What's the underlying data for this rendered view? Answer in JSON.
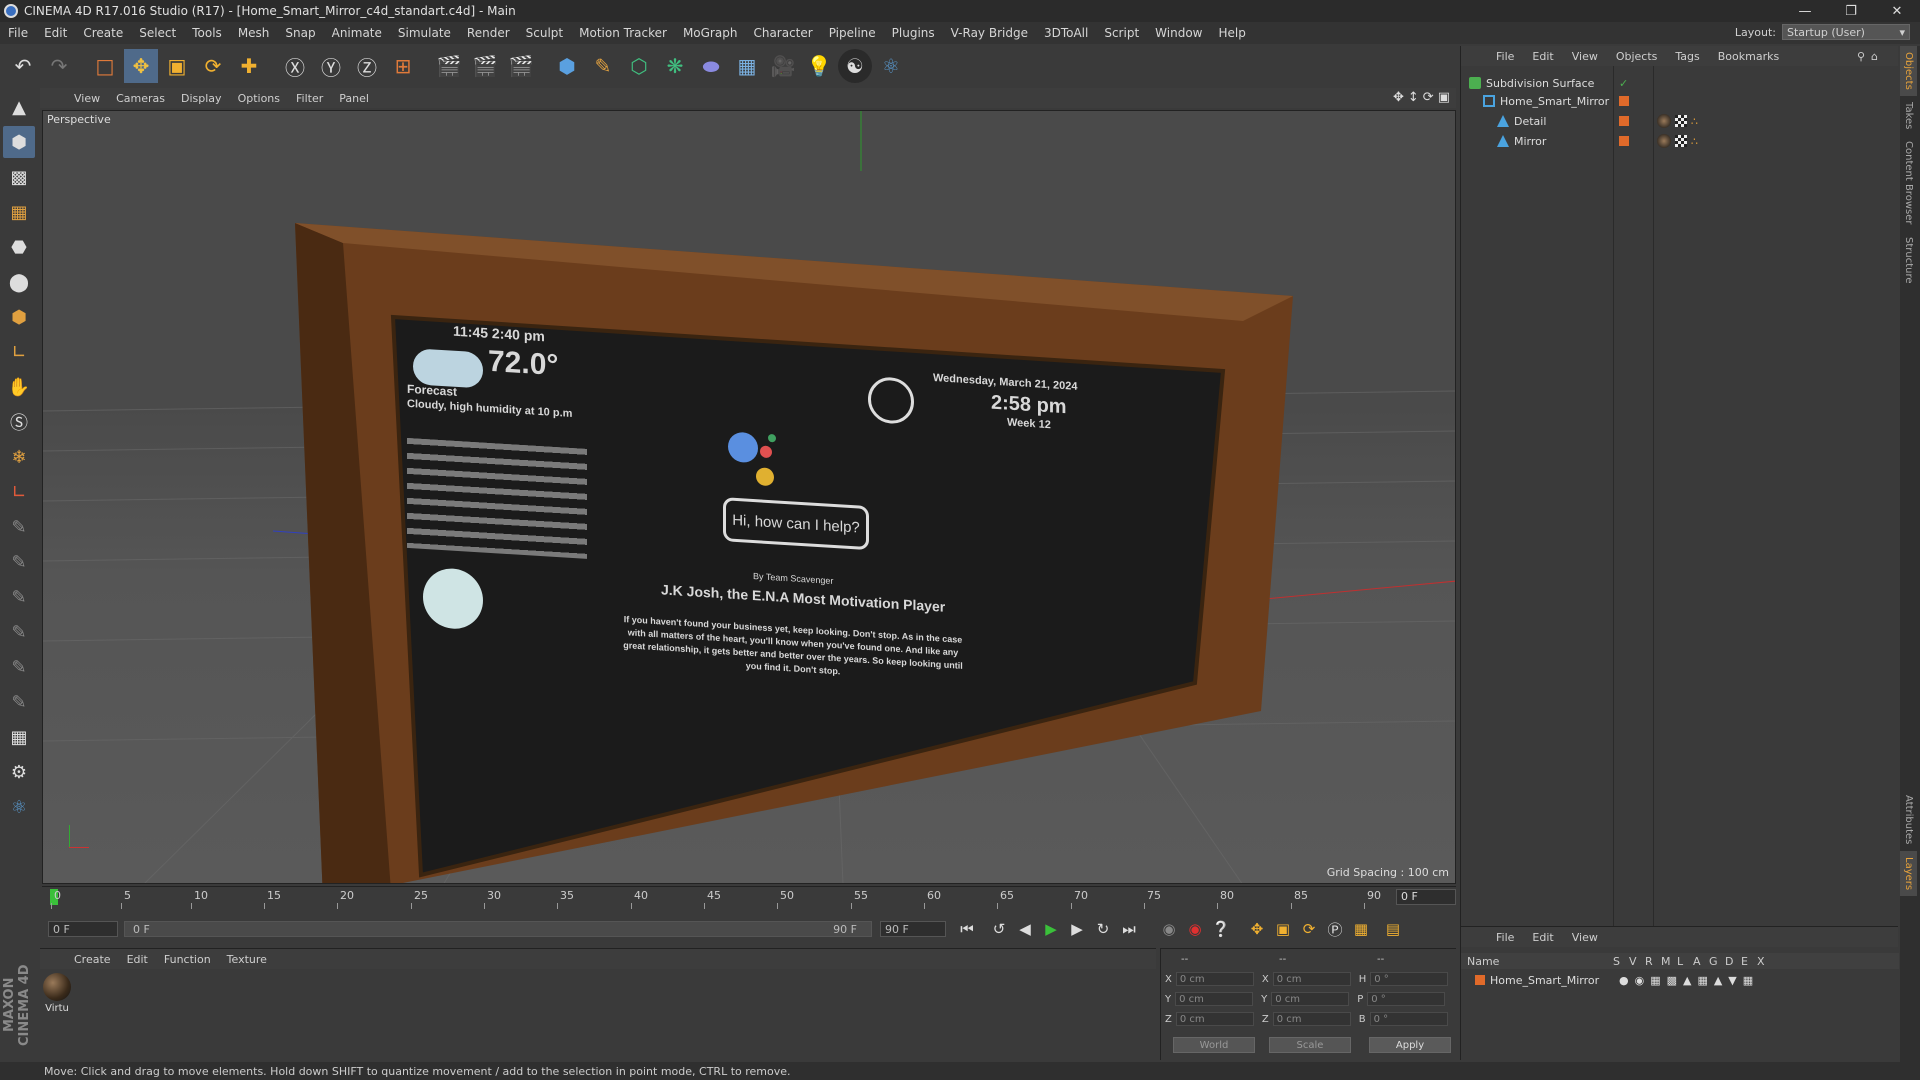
{
  "window": {
    "title": "CINEMA 4D R17.016 Studio (R17) - [Home_Smart_Mirror_c4d_standart.c4d] - Main"
  },
  "menu": [
    "File",
    "Edit",
    "Create",
    "Select",
    "Tools",
    "Mesh",
    "Snap",
    "Animate",
    "Simulate",
    "Render",
    "Sculpt",
    "Motion Tracker",
    "MoGraph",
    "Character",
    "Pipeline",
    "Plugins",
    "V-Ray Bridge",
    "3DToAll",
    "Script",
    "Window",
    "Help"
  ],
  "layout": {
    "label": "Layout:",
    "value": "Startup (User)"
  },
  "viewport": {
    "menu": [
      "View",
      "Cameras",
      "Display",
      "Options",
      "Filter",
      "Panel"
    ],
    "label": "Perspective",
    "grid_spacing": "Grid Spacing : 100 cm"
  },
  "mirror_screen": {
    "time_small": "11:45 2:40 pm",
    "temperature": "72.0°",
    "forecast_title": "Forecast",
    "forecast_desc": "Cloudy, high humidity at 10 p.m",
    "date": "Wednesday, March 21, 2024",
    "time": "2:58 pm",
    "week": "Week 12",
    "assistant_prompt": "Hi, how can I help?",
    "news_source": "By Team Scavenger",
    "headline": "J.K Josh, the E.N.A Most Motivation Player",
    "quote": "If you haven't found your business yet, keep looking. Don't stop. As in the case with all matters of the heart, you'll know when you've found one. And like any great relationship, it gets better and better over the years. So keep looking until you find it. Don't stop."
  },
  "timeline": {
    "ticks": [
      "0",
      "5",
      "10",
      "15",
      "20",
      "25",
      "30",
      "35",
      "40",
      "45",
      "50",
      "55",
      "60",
      "65",
      "70",
      "75",
      "80",
      "85",
      "90"
    ],
    "current_frame": "0 F"
  },
  "playback": {
    "start": "0 F",
    "range_start": "0 F",
    "range_end": "90 F",
    "end": "90 F"
  },
  "materials": {
    "menu": [
      "Create",
      "Edit",
      "Function",
      "Texture"
    ],
    "items": [
      {
        "name": "Virtu"
      }
    ]
  },
  "coords": {
    "header": [
      "--",
      "--",
      "--"
    ],
    "rows": [
      {
        "a": "X",
        "av": "0 cm",
        "b": "X",
        "bv": "0 cm",
        "c": "H",
        "cv": "0 °"
      },
      {
        "a": "Y",
        "av": "0 cm",
        "b": "Y",
        "bv": "0 cm",
        "c": "P",
        "cv": "0 °"
      },
      {
        "a": "Z",
        "av": "0 cm",
        "b": "Z",
        "bv": "0 cm",
        "c": "B",
        "cv": "0 °"
      }
    ],
    "mode": "World",
    "scale": "Scale",
    "apply": "Apply"
  },
  "objects_panel": {
    "menu": [
      "File",
      "Edit",
      "View",
      "Objects",
      "Tags",
      "Bookmarks"
    ],
    "items": [
      {
        "name": "Subdivision Surface",
        "color": "#4caf50"
      },
      {
        "name": "Home_Smart_Mirror",
        "color": "#4aa3df"
      },
      {
        "name": "Detail",
        "color": "#4aa3df"
      },
      {
        "name": "Mirror",
        "color": "#4aa3df"
      }
    ]
  },
  "attributes_panel": {
    "menu": [
      "File",
      "Edit",
      "View"
    ],
    "columns": [
      "Name",
      "S",
      "V",
      "R",
      "M",
      "L",
      "A",
      "G",
      "D",
      "E",
      "X"
    ],
    "row": "Home_Smart_Mirror"
  },
  "side_tabs": [
    "Objects",
    "Takes",
    "Content Browser",
    "Structure",
    "Attributes",
    "Layers"
  ],
  "status": "Move: Click and drag to move elements. Hold down SHIFT to quantize movement / add to the selection in point mode, CTRL to remove.",
  "colors": {
    "accent": "#e8a33b",
    "wood": "#6b3d1c",
    "screen": "#1b1b1b"
  }
}
